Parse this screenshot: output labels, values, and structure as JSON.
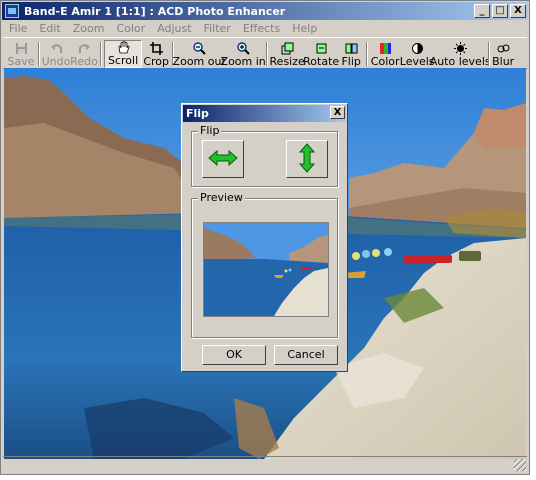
{
  "window": {
    "title": "Band-E Amir 1 [1:1] : ACD Photo Enhancer",
    "controls": [
      "_",
      "□",
      "X"
    ]
  },
  "menu": [
    "File",
    "Edit",
    "Zoom",
    "Color",
    "Adjust",
    "Filter",
    "Effects",
    "Help"
  ],
  "toolbar": [
    {
      "label": "Save",
      "icon": "save-icon",
      "enabled": false
    },
    {
      "label": "Undo",
      "icon": "undo-icon",
      "enabled": false
    },
    {
      "label": "Redo",
      "icon": "redo-icon",
      "enabled": false
    },
    {
      "label": "Scroll",
      "icon": "hand-icon",
      "enabled": true,
      "active": true
    },
    {
      "label": "Crop",
      "icon": "crop-icon",
      "enabled": true
    },
    {
      "label": "Zoom out",
      "icon": "zoom-out-icon",
      "enabled": true
    },
    {
      "label": "Zoom in",
      "icon": "zoom-in-icon",
      "enabled": true
    },
    {
      "label": "Resize",
      "icon": "resize-icon",
      "enabled": true
    },
    {
      "label": "Rotate",
      "icon": "rotate-icon",
      "enabled": true
    },
    {
      "label": "Flip",
      "icon": "flip-icon",
      "enabled": true
    },
    {
      "label": "Color",
      "icon": "color-icon",
      "enabled": true
    },
    {
      "label": "Levels",
      "icon": "levels-icon",
      "enabled": true
    },
    {
      "label": "Auto levels",
      "icon": "auto-levels-icon",
      "enabled": true
    },
    {
      "label": "Blur",
      "icon": "blur-icon",
      "enabled": true
    }
  ],
  "dialog": {
    "title": "Flip",
    "close": "X",
    "flip_group": "Flip",
    "preview_group": "Preview",
    "horizontal_icon": "horizontal-flip-arrow-icon",
    "vertical_icon": "vertical-flip-arrow-icon",
    "ok": "OK",
    "cancel": "Cancel"
  },
  "colors": {
    "title_start": "#0a246a",
    "title_end": "#a6caf0",
    "face": "#d4d0c8",
    "arrow_green": "#22c02a"
  }
}
